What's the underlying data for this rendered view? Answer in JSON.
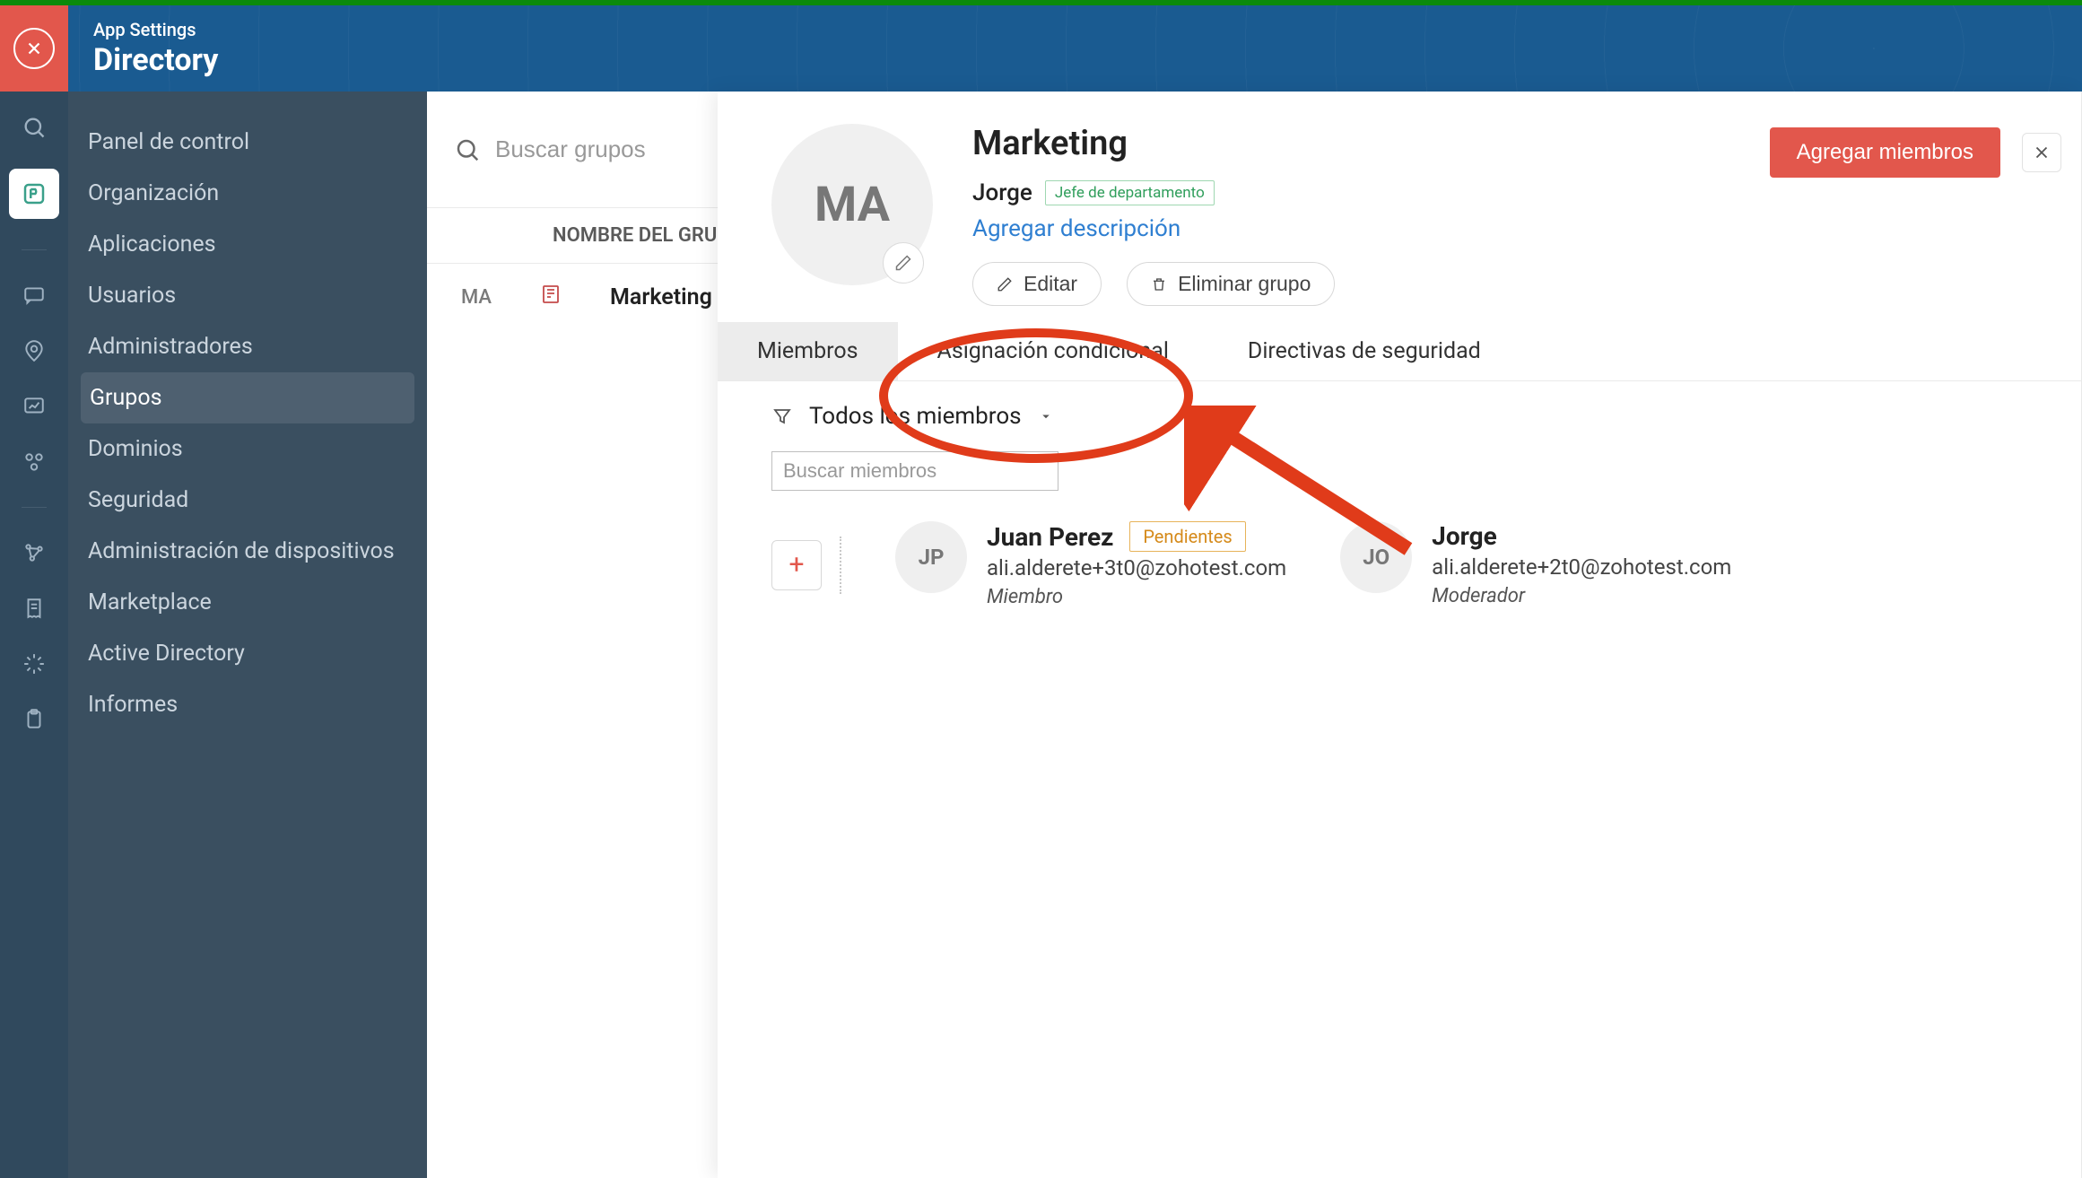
{
  "header": {
    "sup": "App Settings",
    "main": "Directory"
  },
  "sidebar": {
    "items": [
      {
        "label": "Panel de control"
      },
      {
        "label": "Organización"
      },
      {
        "label": "Aplicaciones"
      },
      {
        "label": "Usuarios"
      },
      {
        "label": "Administradores"
      },
      {
        "label": "Grupos"
      },
      {
        "label": "Dominios"
      },
      {
        "label": "Seguridad"
      },
      {
        "label": "Administración de dispositivos"
      },
      {
        "label": "Marketplace"
      },
      {
        "label": "Active Directory"
      },
      {
        "label": "Informes"
      }
    ],
    "active_index": 5
  },
  "content": {
    "search_placeholder": "Buscar grupos",
    "column_header": "NOMBRE DEL GRUPO",
    "row": {
      "abbr": "MA",
      "name": "Marketing"
    }
  },
  "detail": {
    "avatar_initials": "MA",
    "title": "Marketing",
    "owner": "Jorge",
    "owner_badge": "Jefe de departamento",
    "add_description": "Agregar descripción",
    "edit": "Editar",
    "delete": "Eliminar grupo",
    "add_members_btn": "Agregar miembros",
    "tabs": [
      "Miembros",
      "Asignación condicional",
      "Directivas de seguridad"
    ],
    "active_tab": 0,
    "filter_label": "Todos los miembros",
    "member_search_placeholder": "Buscar miembros",
    "members": [
      {
        "initials": "JP",
        "name": "Juan Perez",
        "email": "ali.alderete+3t0@zohotest.com",
        "role": "Miembro",
        "pending": "Pendientes"
      },
      {
        "initials": "JO",
        "name": "Jorge",
        "email": "ali.alderete+2t0@zohotest.com",
        "role": "Moderador",
        "pending": null
      }
    ]
  },
  "colors": {
    "accent_red": "#e2574c",
    "header_blue": "#1a5b91",
    "sidebar_bg": "#3a4f60",
    "rail_bg": "#30495d",
    "annotation": "#e03b1a"
  }
}
